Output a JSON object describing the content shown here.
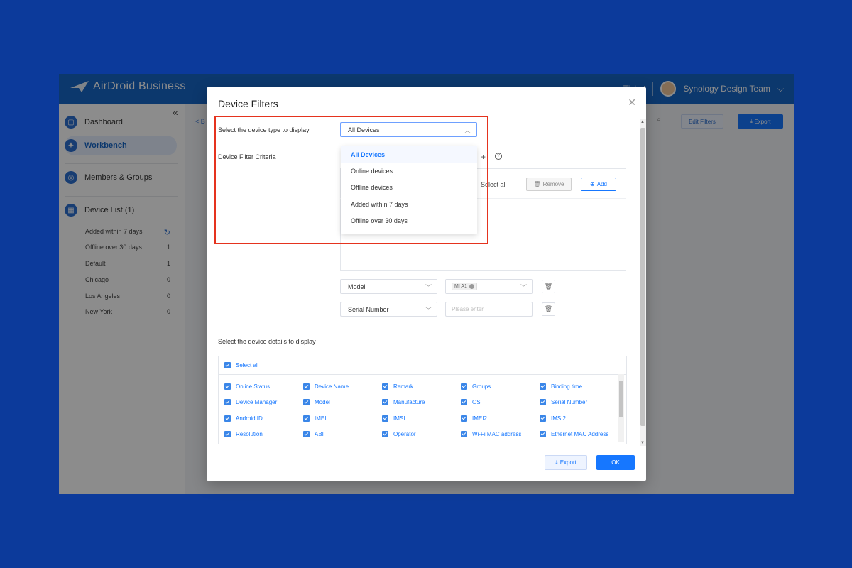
{
  "app": {
    "brand_name": "AirDroid Business",
    "brand_sub": "BUSINESS",
    "ticket_label": "Ticket",
    "user_name": "Synology Design Team",
    "crumb": "< B",
    "edit_filters_label": "Edit Filters",
    "export_label": "Export"
  },
  "sidebar": {
    "collapse_glyph": "«",
    "items": [
      {
        "label": "Dashboard"
      },
      {
        "label": "Workbench"
      },
      {
        "label": "Members & Groups"
      },
      {
        "label": "Device List (1)"
      }
    ],
    "sub_items": [
      {
        "label": "Added within 7 days",
        "count": ""
      },
      {
        "label": "Offline over 30 days",
        "count": "1"
      },
      {
        "label": "Default",
        "count": "1"
      },
      {
        "label": "Chicago",
        "count": "0"
      },
      {
        "label": "Los Angeles",
        "count": "0"
      },
      {
        "label": "New York",
        "count": "0"
      }
    ]
  },
  "modal": {
    "title": "Device Filters",
    "device_type_label": "Select the device type to display",
    "device_type_value": "All Devices",
    "dropdown_options": [
      "All Devices",
      "Online devices",
      "Offline devices",
      "Added within 7 days",
      "Offline over 30 days"
    ],
    "filter_criteria_label": "Device Filter Criteria",
    "select_all_label": "Select all",
    "remove_label": "Remove",
    "add_label": "Add",
    "criteria": [
      {
        "field": "Model",
        "value_tag": "MI A1",
        "placeholder": ""
      },
      {
        "field": "Serial Number",
        "value_tag": "",
        "placeholder": "Please enter"
      }
    ],
    "details_label": "Select the device details to display",
    "details_select_all": "Select all",
    "details_rows": [
      [
        "Online Status",
        "Device Name",
        "Remark",
        "Groups",
        "Binding time"
      ],
      [
        "Device Manager",
        "Model",
        "Manufacture",
        "OS",
        "Serial Number"
      ],
      [
        "Android ID",
        "IMEI",
        "IMSI",
        "IMEI2",
        "IMSI2"
      ],
      [
        "Resolution",
        "ABI",
        "Operator",
        "Wi-Fi MAC address",
        "Ethernet MAC Address"
      ]
    ],
    "export_label": "Export",
    "ok_label": "OK"
  }
}
